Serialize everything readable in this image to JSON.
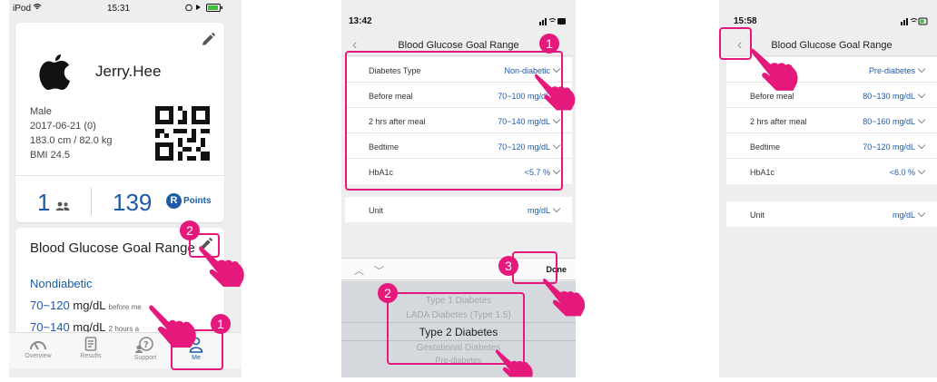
{
  "panel1": {
    "status": {
      "carrier": "iPod",
      "time": "15:31"
    },
    "profile": {
      "name": "Jerry.Hee",
      "gender": "Male",
      "birth": "2017-06-21 (0)",
      "body": "183.0 cm / 82.0 kg",
      "bmi": "BMI 24.5",
      "followers": "1",
      "points": "139",
      "points_badge": "R",
      "points_label": "Points"
    },
    "goal_card": {
      "title": "Blood Glucose Goal Range",
      "type": "Nondiabetic",
      "rows": [
        {
          "range": "70~120",
          "unit": "mg/dL",
          "desc": "before me"
        },
        {
          "range": "70~140",
          "unit": "mg/dL",
          "desc": "2 hours a"
        }
      ]
    },
    "tabs": [
      {
        "label": "Overview",
        "icon": "gauge-icon"
      },
      {
        "label": "Results",
        "icon": "document-icon"
      },
      {
        "label": "Support",
        "icon": "support-icon"
      },
      {
        "label": "Me",
        "icon": "person-icon"
      }
    ],
    "badges": [
      "2",
      "1"
    ]
  },
  "panel2": {
    "status": {
      "time": "13:42"
    },
    "title": "Blood Glucose Goal Range",
    "rows": [
      {
        "label": "Diabetes Type",
        "value": "Non-diabetic"
      },
      {
        "label": "Before meal",
        "value": "70~100 mg/dL"
      },
      {
        "label": "2 hrs after meal",
        "value": "70~140 mg/dL"
      },
      {
        "label": "Bedtime",
        "value": "70~120 mg/dL"
      },
      {
        "label": "HbA1c",
        "value": "<5.7 %"
      }
    ],
    "unit_row": {
      "label": "Unit",
      "value": "mg/dL"
    },
    "toolbar": {
      "arrows": "︿ ﹀",
      "done": "Done"
    },
    "picker_options": [
      "Type 1 Diabetes",
      "LADA Diabetes (Type 1.5)",
      "Type 2 Diabetes",
      "Gestational Diabetes",
      "Pre-diabetes"
    ],
    "picker_selected_index": 2,
    "badges": [
      "1",
      "2",
      "3"
    ]
  },
  "panel3": {
    "status": {
      "time": "15:58"
    },
    "title": "Blood Glucose Goal Range",
    "rows": [
      {
        "label": "ype",
        "value": "Pre-diabetes"
      },
      {
        "label": "Before meal",
        "value": "80~130 mg/dL"
      },
      {
        "label": "2 hrs after meal",
        "value": "80~160 mg/dL"
      },
      {
        "label": "Bedtime",
        "value": "70~120 mg/dL"
      },
      {
        "label": "HbA1c",
        "value": "<6.0 %"
      }
    ],
    "unit_row": {
      "label": "Unit",
      "value": "mg/dL"
    }
  },
  "colors": {
    "accent": "#1e5ba6",
    "annotation": "#e5197c",
    "background": "#eeeeee"
  }
}
